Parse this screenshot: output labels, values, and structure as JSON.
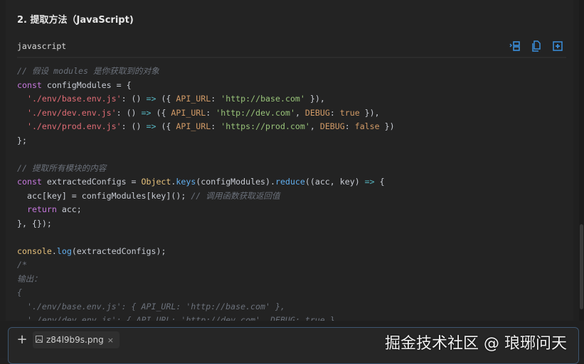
{
  "section_heading": "2. 提取方法（JavaScript)",
  "code_block": {
    "language": "javascript",
    "actions": [
      {
        "name": "wrap-icon"
      },
      {
        "name": "copy-icon"
      },
      {
        "name": "insert-icon"
      }
    ],
    "lines": [
      [
        [
          "// 假设 modules 是你获取到的对象",
          "cm"
        ]
      ],
      [
        [
          "const",
          "kw"
        ],
        [
          " configModules = {",
          "txt"
        ]
      ],
      [
        [
          "  ",
          "txt"
        ],
        [
          "'./env/base.env.js'",
          "key"
        ],
        [
          ": () ",
          "txt"
        ],
        [
          "=>",
          "op"
        ],
        [
          " ({ ",
          "txt"
        ],
        [
          "API_URL",
          "prop"
        ],
        [
          ": ",
          "txt"
        ],
        [
          "'http://base.com'",
          "str"
        ],
        [
          " }),",
          "txt"
        ]
      ],
      [
        [
          "  ",
          "txt"
        ],
        [
          "'./env/dev.env.js'",
          "key"
        ],
        [
          ": () ",
          "txt"
        ],
        [
          "=>",
          "op"
        ],
        [
          " ({ ",
          "txt"
        ],
        [
          "API_URL",
          "prop"
        ],
        [
          ": ",
          "txt"
        ],
        [
          "'http://dev.com'",
          "str"
        ],
        [
          ", ",
          "txt"
        ],
        [
          "DEBUG",
          "prop"
        ],
        [
          ": ",
          "txt"
        ],
        [
          "true",
          "bool"
        ],
        [
          " }),",
          "txt"
        ]
      ],
      [
        [
          "  ",
          "txt"
        ],
        [
          "'./env/prod.env.js'",
          "key"
        ],
        [
          ": () ",
          "txt"
        ],
        [
          "=>",
          "op"
        ],
        [
          " ({ ",
          "txt"
        ],
        [
          "API_URL",
          "prop"
        ],
        [
          ": ",
          "txt"
        ],
        [
          "'https://prod.com'",
          "str"
        ],
        [
          ", ",
          "txt"
        ],
        [
          "DEBUG",
          "prop"
        ],
        [
          ": ",
          "txt"
        ],
        [
          "false",
          "bool"
        ],
        [
          " })",
          "txt"
        ]
      ],
      [
        [
          "};",
          "txt"
        ]
      ],
      [
        [
          "",
          "txt"
        ]
      ],
      [
        [
          "// 提取所有模块的内容",
          "cm"
        ]
      ],
      [
        [
          "const",
          "kw"
        ],
        [
          " extractedConfigs = ",
          "txt"
        ],
        [
          "Object",
          "obj"
        ],
        [
          ".",
          "txt"
        ],
        [
          "keys",
          "fn"
        ],
        [
          "(configModules).",
          "txt"
        ],
        [
          "reduce",
          "fn"
        ],
        [
          "((acc, key) ",
          "txt"
        ],
        [
          "=>",
          "op"
        ],
        [
          " {",
          "txt"
        ]
      ],
      [
        [
          "  acc[key] = configModules[key](); ",
          "txt"
        ],
        [
          "// 调用函数获取返回值",
          "cm"
        ]
      ],
      [
        [
          "  ",
          "txt"
        ],
        [
          "return",
          "kw"
        ],
        [
          " acc;",
          "txt"
        ]
      ],
      [
        [
          "}, {});",
          "txt"
        ]
      ],
      [
        [
          "",
          "txt"
        ]
      ],
      [
        [
          "console",
          "obj"
        ],
        [
          ".",
          "txt"
        ],
        [
          "log",
          "fn"
        ],
        [
          "(extractedConfigs);",
          "txt"
        ]
      ],
      [
        [
          "/*",
          "cm"
        ]
      ],
      [
        [
          "输出：",
          "cm"
        ]
      ],
      [
        [
          "{",
          "cm"
        ]
      ],
      [
        [
          "  './env/base.env.js': { API_URL: 'http://base.com' },",
          "cm"
        ]
      ],
      [
        [
          "  './env/dev.env.js': { API_URL: 'http://dev.com', DEBUG: true },",
          "cm"
        ]
      ]
    ]
  },
  "composer": {
    "add_label": "+",
    "attachment": {
      "filename": "z84l9b9s.png",
      "close": "×"
    },
    "watermark": "掘金技术社区 @ 琅琊问天"
  },
  "colors": {
    "accent": "#3b8fdc",
    "background": "#232323"
  }
}
